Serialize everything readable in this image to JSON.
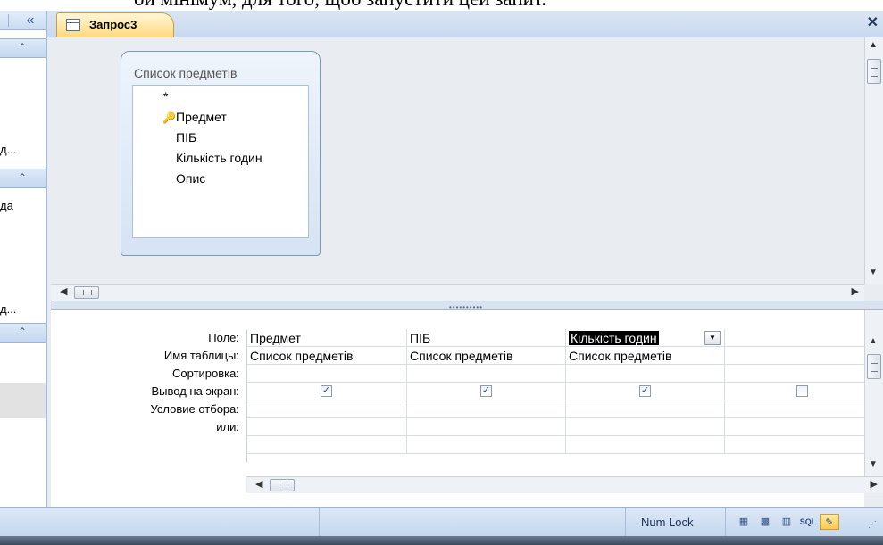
{
  "doc_snippet": "ой мінімум, для того, щоб запустити цей запит.",
  "nav": {
    "collapse_icon": "«",
    "group_icon": "⌃",
    "items": [
      "д...",
      "да",
      "д..."
    ]
  },
  "tab": {
    "title": "Запрос3"
  },
  "window": {
    "close_label": "✕"
  },
  "table_box": {
    "title": "Список предметів",
    "fields": [
      "*",
      "Предмет",
      "ПІБ",
      "Кількість годин",
      "Опис"
    ]
  },
  "grid": {
    "row_labels": [
      "Поле:",
      "Имя таблицы:",
      "Сортировка:",
      "Вывод на экран:",
      "Условие отбора:",
      "или:"
    ],
    "columns": [
      {
        "field": "Предмет",
        "table": "Список предметів",
        "show": true
      },
      {
        "field": "ПІБ",
        "table": "Список предметів",
        "show": true
      },
      {
        "field": "Кількість годин",
        "table": "Список предметів",
        "show": true
      },
      {
        "field": "",
        "table": "",
        "show": false
      }
    ]
  },
  "status": {
    "numlock": "Num Lock",
    "views": [
      "datasheet-view",
      "pivottable-view",
      "pivotchart-view",
      "sql-view",
      "design-view"
    ],
    "sql_label": "SQL"
  }
}
